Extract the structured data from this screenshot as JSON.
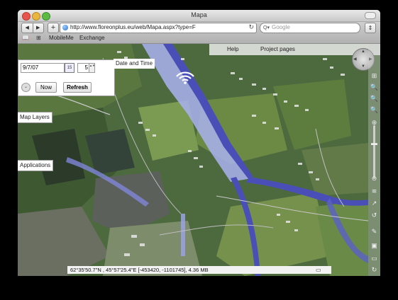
{
  "window": {
    "title": "Mapa"
  },
  "toolbar": {
    "back_icon": "◀",
    "forward_icon": "▶",
    "add_icon": "+",
    "url": "http://www.floreonplus.eu/web/Mapa.aspx?type=F",
    "search_placeholder": "Google",
    "search_icon": "Q▾",
    "reload_icon": "↻",
    "bookmarks_icon": "⇕"
  },
  "bookmarks": {
    "book_icon": "📖",
    "grid_icon": "⊞",
    "items": [
      "MobileMe",
      "Exchange"
    ]
  },
  "map_header": {
    "help": "Help",
    "project_pages": "Project pages"
  },
  "panel": {
    "date_value": "9/7/07",
    "calendar_label": "15",
    "hour_value": "5",
    "spinner_label": "▲▼",
    "dropdown_label": "⌄",
    "now_label": "Now",
    "refresh_label": "Refresh",
    "date_time_label": "Date and Time"
  },
  "tabs": {
    "map_layers": "Map Layers",
    "applications": "Applications"
  },
  "navwheel": {
    "up": "▲",
    "down": "▼",
    "left": "◀",
    "right": "▶"
  },
  "right_toolbar": {
    "icons": [
      "⊞",
      "🔍",
      "🔍",
      "🔍",
      "⊕",
      "▬",
      "⊖",
      "≋",
      "↗",
      "↺",
      "✎",
      "▣",
      "▭",
      "↻"
    ]
  },
  "status": {
    "text": "62°35'50.7\"N , 45°57'25.4\"E [-453420, -1101745], 4.36 MB",
    "monitor_icon": "▭"
  },
  "colors": {
    "water": "#4a4fb8",
    "flood": "#aab2f0",
    "land": "#4d6a3f"
  }
}
